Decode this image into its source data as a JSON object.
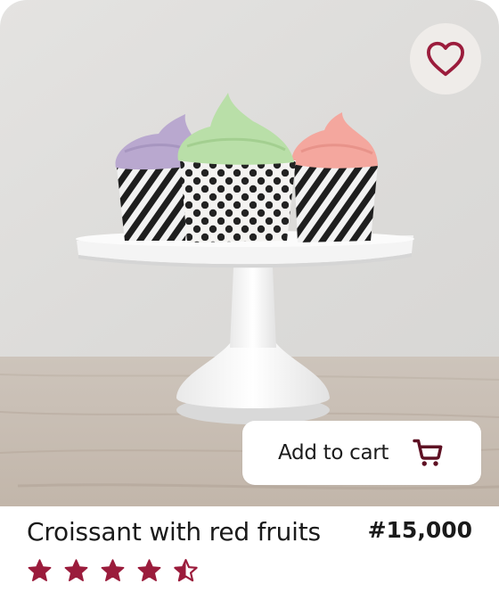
{
  "product": {
    "title": "Croissant with red fruits",
    "price": "#15,000",
    "rating": 4.5,
    "rating_max": 5
  },
  "actions": {
    "add_to_cart_label": "Add to cart",
    "favorite_icon": "heart-icon",
    "cart_icon": "cart-icon"
  },
  "colors": {
    "accent": "#9b1c3c",
    "background": "#ffffff",
    "favorite_bg": "#efece9"
  }
}
